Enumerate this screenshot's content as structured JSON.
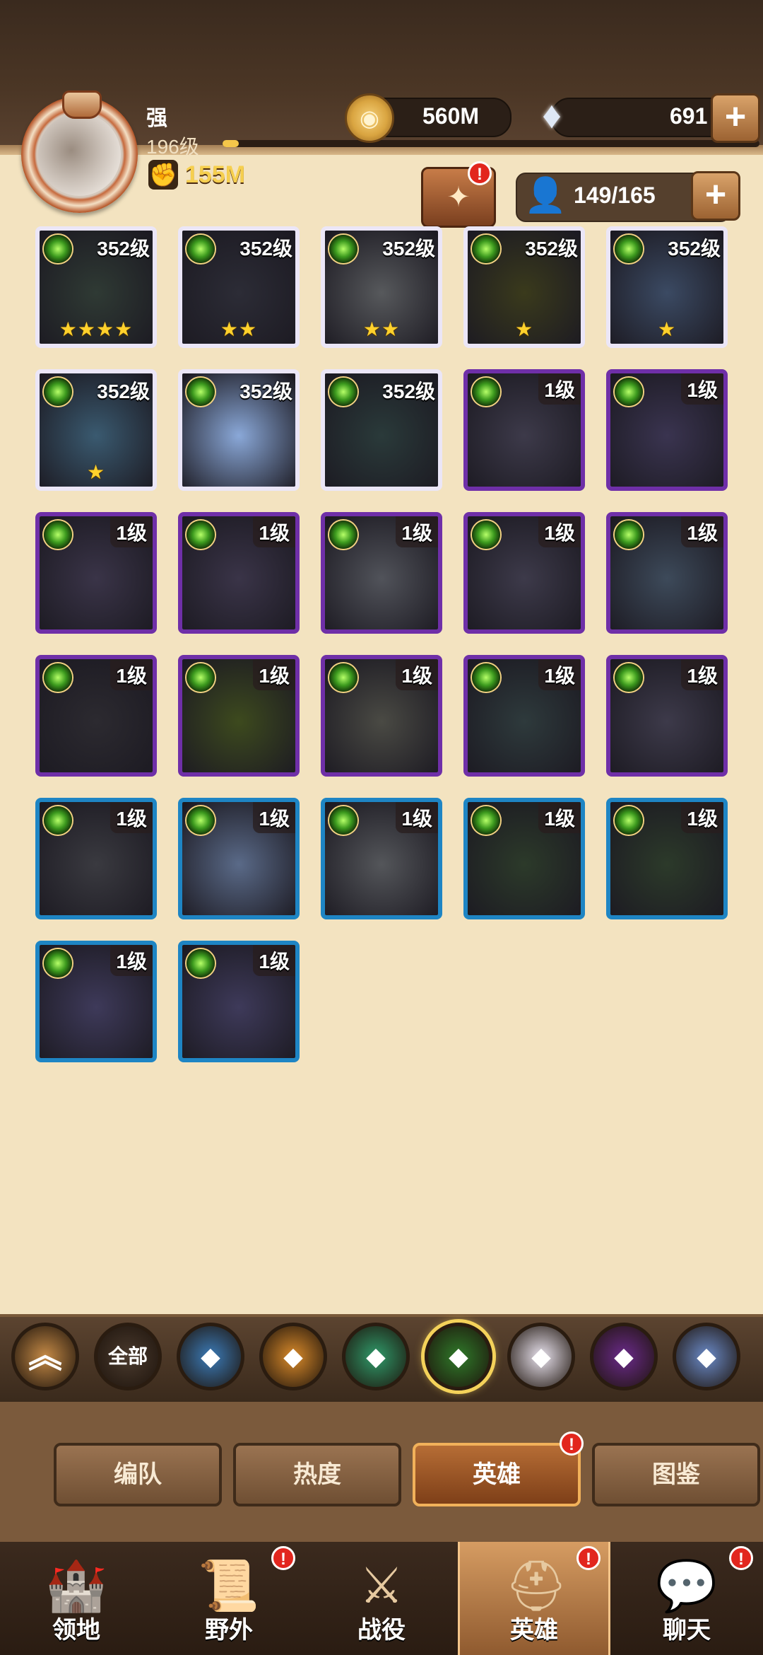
{
  "player": {
    "name": "强",
    "level": "196级",
    "exp_fraction": 0.03,
    "power": "155M"
  },
  "resources": {
    "gold": "560M",
    "diamonds": "691",
    "add_symbol": "+"
  },
  "roster": {
    "slots": "149/165",
    "notification": "!"
  },
  "heroes": [
    {
      "level": "352级",
      "stars": "★★★★",
      "frame": "ascended",
      "tint": "#2f3a34"
    },
    {
      "level": "352级",
      "stars": "★★",
      "frame": "ascended",
      "tint": "#2c2c36"
    },
    {
      "level": "352级",
      "stars": "★★",
      "frame": "ascended",
      "tint": "#57595c"
    },
    {
      "level": "352级",
      "stars": "★",
      "frame": "ascended",
      "tint": "#3a3a1c"
    },
    {
      "level": "352级",
      "stars": "★",
      "frame": "ascended",
      "tint": "#3b4a63"
    },
    {
      "level": "352级",
      "stars": "★",
      "frame": "ascended",
      "tint": "#3a5a70"
    },
    {
      "level": "352级",
      "stars": "",
      "frame": "ascended",
      "tint": "#8aa8d8"
    },
    {
      "level": "352级",
      "stars": "",
      "frame": "ascended",
      "tint": "#2a3a3a"
    },
    {
      "level": "1级",
      "stars": "",
      "frame": "purple",
      "tint": "#3d3a4a"
    },
    {
      "level": "1级",
      "stars": "",
      "frame": "purple",
      "tint": "#3a3450"
    },
    {
      "level": "1级",
      "stars": "",
      "frame": "purple",
      "tint": "#3a3448"
    },
    {
      "level": "1级",
      "stars": "",
      "frame": "purple",
      "tint": "#3a3448"
    },
    {
      "level": "1级",
      "stars": "",
      "frame": "purple",
      "tint": "#51535a"
    },
    {
      "level": "1级",
      "stars": "",
      "frame": "purple",
      "tint": "#3d3a4a"
    },
    {
      "level": "1级",
      "stars": "",
      "frame": "purple",
      "tint": "#3d4a5a"
    },
    {
      "level": "1级",
      "stars": "",
      "frame": "purple",
      "tint": "#2c2a30"
    },
    {
      "level": "1级",
      "stars": "",
      "frame": "purple",
      "tint": "#3d4a1e"
    },
    {
      "level": "1级",
      "stars": "",
      "frame": "purple",
      "tint": "#4a4a44"
    },
    {
      "level": "1级",
      "stars": "",
      "frame": "purple",
      "tint": "#2e3a3c"
    },
    {
      "level": "1级",
      "stars": "",
      "frame": "purple",
      "tint": "#3d3a4a"
    },
    {
      "level": "1级",
      "stars": "",
      "frame": "blue",
      "tint": "#3a3a40"
    },
    {
      "level": "1级",
      "stars": "",
      "frame": "blue",
      "tint": "#5a6a88"
    },
    {
      "level": "1级",
      "stars": "",
      "frame": "blue",
      "tint": "#54565a"
    },
    {
      "level": "1级",
      "stars": "",
      "frame": "blue",
      "tint": "#2c3a2a"
    },
    {
      "level": "1级",
      "stars": "",
      "frame": "blue",
      "tint": "#2c3a2a"
    },
    {
      "level": "1级",
      "stars": "",
      "frame": "blue",
      "tint": "#3e3a5a"
    },
    {
      "level": "1级",
      "stars": "",
      "frame": "blue",
      "tint": "#3e3a5a"
    }
  ],
  "filters": [
    {
      "label": "",
      "icon": "chevron-up-icon",
      "color": "#c58a46"
    },
    {
      "label": "全部",
      "icon": "all-icon",
      "color": "#4a3a2e"
    },
    {
      "label": "",
      "icon": "lightbearer-icon",
      "color": "#3b7bb8"
    },
    {
      "label": "",
      "icon": "mauler-icon",
      "color": "#d98a2a"
    },
    {
      "label": "",
      "icon": "wilder-icon",
      "color": "#2f9a6a"
    },
    {
      "label": "",
      "icon": "graveborn-icon",
      "color": "#2f7a2a"
    },
    {
      "label": "",
      "icon": "celestial-icon",
      "color": "#e9e3ef"
    },
    {
      "label": "",
      "icon": "hypogean-icon",
      "color": "#6a2a8a"
    },
    {
      "label": "",
      "icon": "dimensional-icon",
      "color": "#6a8ac8"
    }
  ],
  "subtabs": [
    {
      "label": "编队"
    },
    {
      "label": "热度"
    },
    {
      "label": "英雄",
      "badge": "!"
    },
    {
      "label": "图鉴"
    }
  ],
  "nav": [
    {
      "label": "领地",
      "icon": "castle-icon"
    },
    {
      "label": "野外",
      "icon": "map-scroll-icon",
      "badge": "!"
    },
    {
      "label": "战役",
      "icon": "sword-crest-icon"
    },
    {
      "label": "英雄",
      "icon": "helmet-icon",
      "badge": "!"
    },
    {
      "label": "聊天",
      "icon": "chat-icon",
      "badge": "!"
    }
  ]
}
